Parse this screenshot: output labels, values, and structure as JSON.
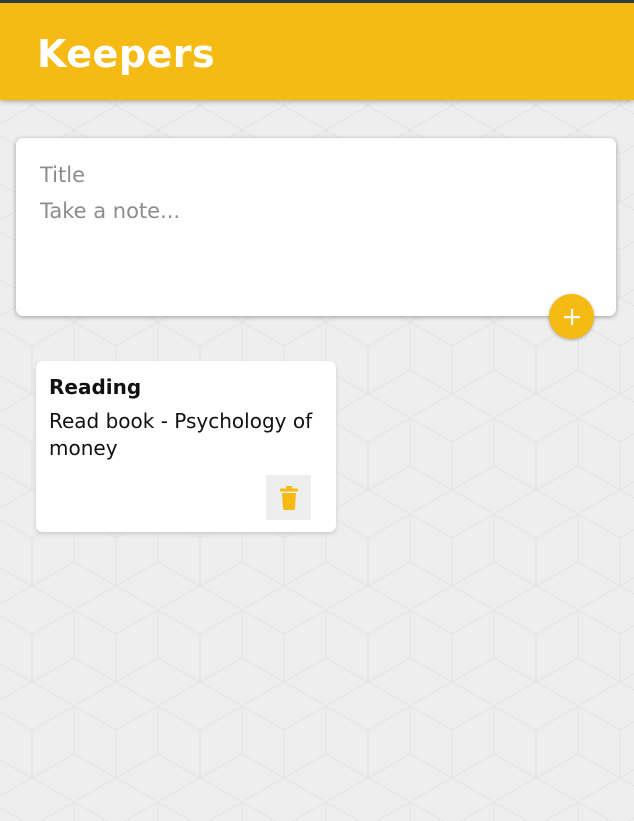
{
  "header": {
    "title": "Keepers",
    "background_color": "#f5ba13"
  },
  "create_note": {
    "title_placeholder": "Title",
    "title_value": "",
    "content_placeholder": "Take a note...",
    "content_value": "",
    "add_icon": "plus-icon"
  },
  "notes": [
    {
      "title": "Reading",
      "content": "Read book - Psychology of money",
      "delete_icon": "trash-icon"
    }
  ],
  "colors": {
    "accent": "#f5ba13",
    "background": "#eeeeee",
    "card": "#ffffff"
  }
}
